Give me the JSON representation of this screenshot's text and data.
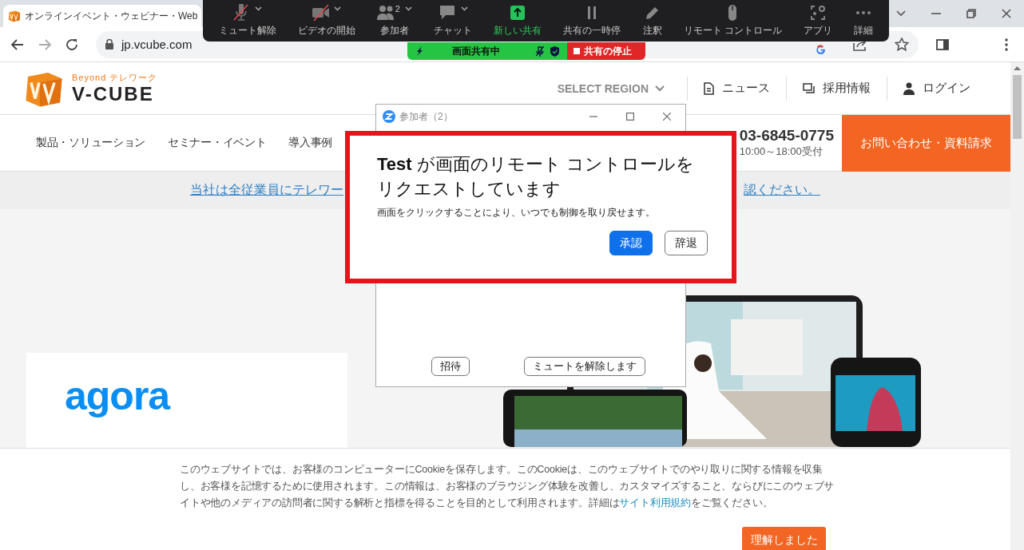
{
  "browser": {
    "tab_title": "オンラインイベント・ウェビナー・Web",
    "url": "jp.vcube.com"
  },
  "zoom_toolbar": {
    "items": [
      {
        "label": "ミュート解除",
        "menu": true,
        "highlighted": false
      },
      {
        "label": "ビデオの開始",
        "menu": true,
        "highlighted": false
      },
      {
        "label": "参加者",
        "count": "2",
        "menu": true,
        "highlighted": false
      },
      {
        "label": "チャット",
        "menu": true,
        "highlighted": false
      },
      {
        "label": "新しい共有",
        "menu": false,
        "highlighted": true
      },
      {
        "label": "共有の一時停",
        "menu": false,
        "highlighted": false
      },
      {
        "label": "注釈",
        "menu": false,
        "highlighted": false
      },
      {
        "label": "リモート コントロール",
        "menu": false,
        "highlighted": false
      },
      {
        "label": "アプリ",
        "menu": false,
        "highlighted": false
      },
      {
        "label": "詳細",
        "menu": false,
        "highlighted": false
      }
    ]
  },
  "sharing_bar": {
    "status": "画面共有中",
    "stop": "共有の停止"
  },
  "site": {
    "header": {
      "tagline": "Beyond テレワーク",
      "logo_name": "V-CUBE",
      "region": "SELECT REGION",
      "links": [
        "ニュース",
        "採用情報",
        "ログイン"
      ]
    },
    "nav": {
      "items": [
        "製品・ソリューション",
        "セミナー・イベント",
        "導入事例"
      ],
      "phone": "03-6845-0775",
      "hours": "10:00～18:00受付",
      "cta": "お問い合わせ・資料請求"
    },
    "notice": {
      "left": "当社は全従業員にテレワー",
      "right": "認ください。"
    },
    "hero": {
      "brand": "agora"
    }
  },
  "participants_window": {
    "title": "参加者（2）",
    "buttons": [
      "招待",
      "ミュートを解除します"
    ]
  },
  "remote_request": {
    "title": "**Test** が画面のリモート コントロールをリクエストしています",
    "message": "画面をクリックすることにより、いつでも制御を取り戻せます。",
    "buttons": [
      {
        "label": "承認",
        "kind": "primary"
      },
      {
        "label": "辞退",
        "kind": "secondary"
      }
    ]
  },
  "cookie_banner": {
    "text": "このウェブサイトでは、お客様のコンピューターにCookieを保存します。このCookieは、このウェブサイトでのやり取りに関する情報を収集し、お客様を記憶するために使用されます。この情報は、お客様のブラウジング体験を改善し、カスタマイズすること、ならびにこのウェブサイトや他のメディアの訪問者に関する解析と指標を得ることを目的として利用されます。詳細は",
    "link": "サイト利用規約",
    "text_end": "をご覧ください。",
    "button": "理解しました"
  }
}
